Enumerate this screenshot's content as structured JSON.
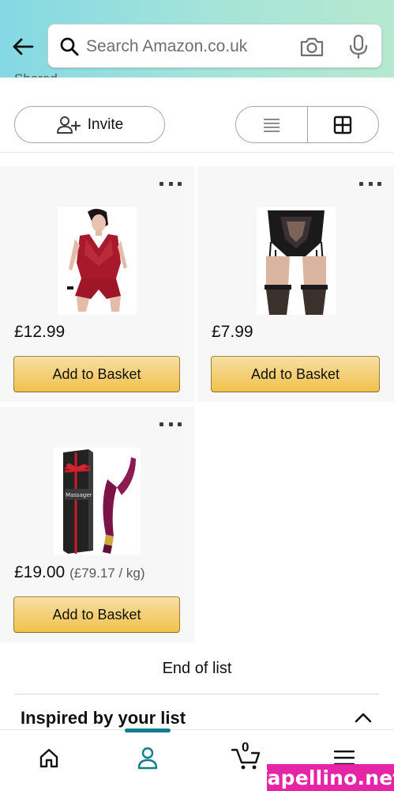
{
  "header": {
    "search_placeholder": "Search Amazon.co.uk"
  },
  "list": {
    "shared_label": "Shared",
    "invite_label": "Invite",
    "view_modes": [
      "list",
      "grid"
    ],
    "selected_view": "grid"
  },
  "products": [
    {
      "price": "£12.99",
      "unit_price": "",
      "button_label": "Add to Basket",
      "image_icon": "red-lace-bodysuit-image"
    },
    {
      "price": "£7.99",
      "unit_price": "",
      "button_label": "Add to Basket",
      "image_icon": "black-lace-suspender-image"
    },
    {
      "price": "£19.00",
      "unit_price": "(£79.17 / kg)",
      "button_label": "Add to Basket",
      "image_icon": "massager-box-image"
    }
  ],
  "end_of_list": "End of list",
  "inspired": {
    "title": "Inspired by your list"
  },
  "bottom_nav": {
    "items": [
      "home",
      "account",
      "cart",
      "menu"
    ],
    "active": "account",
    "cart_count": "0"
  },
  "watermark": "fapellino.net",
  "colors": {
    "header_gradient_start": "#84d8e3",
    "header_gradient_end": "#b6e8cf",
    "button_yellow": "#f0c14b",
    "active_nav": "#0a7e8c",
    "watermark_bg": "#e624a6"
  }
}
